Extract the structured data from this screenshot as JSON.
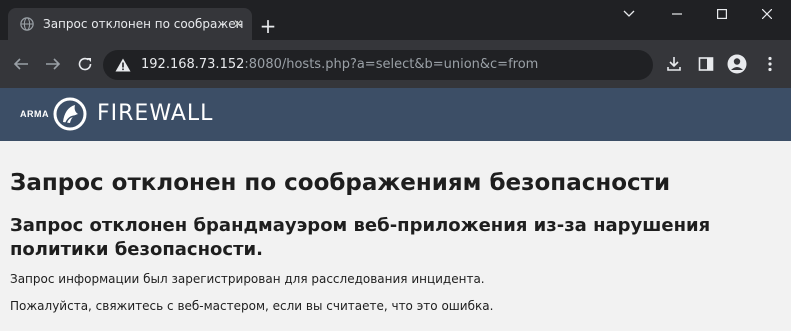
{
  "browser": {
    "tab": {
      "title": "Запрос отклонен по соображен",
      "close_glyph": "✕",
      "favicon": "globe-icon"
    },
    "new_tab_glyph": "+",
    "address": {
      "host": "192.168.73.152",
      "rest": ":8080/hosts.php?a=select&b=union&c=from",
      "security_icon": "warning-icon"
    },
    "colors": {
      "tabstrip": "#202124",
      "toolbar": "#35363a",
      "omnibox": "#202124"
    }
  },
  "site": {
    "brand_small": "ARMA",
    "brand_name": "FIREWALL",
    "header_color": "#3c4e66"
  },
  "page": {
    "heading": "Запрос отклонен по соображениям безопасности",
    "subheading": "Запрос отклонен брандмауэром веб-приложения из-за нарушения политики безопасности.",
    "paragraph1": "Запрос информации был зарегистрирован для расследования инцидента.",
    "paragraph2": "Пожалуйста, свяжитесь с веб-мастером, если вы считаете, что это ошибка."
  }
}
